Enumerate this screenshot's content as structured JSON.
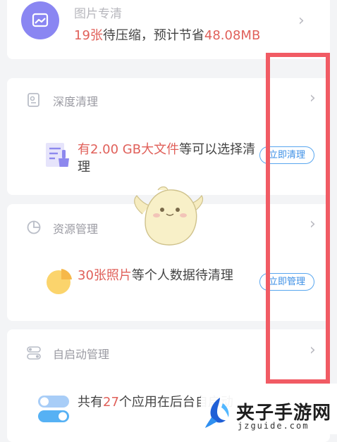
{
  "photo_card": {
    "title": "图片专清",
    "count": "19张",
    "mid_text": "待压缩，预计节省",
    "size": "48.08MB",
    "icon": "image-icon"
  },
  "deep_clean": {
    "title": "深度清理",
    "highlight": "有2.00 GB大文件",
    "text": "等可以选择清理",
    "button": "立即清理",
    "icon": "deep-clean-icon",
    "feature_icon": "file-broom-icon"
  },
  "resource": {
    "title": "资源管理",
    "highlight": "30张照片",
    "text": "等个人数据待清理",
    "button": "立即管理",
    "icon": "pie-chart-icon",
    "feature_icon": "pie-chart-yellow-icon"
  },
  "autostart": {
    "title": "自启动管理",
    "prefix": "共有",
    "count": "27",
    "text": "个应用在后台自启动",
    "icon": "toggle-outline-icon",
    "feature_icon": "toggle-switches-icon"
  },
  "watermark": {
    "name": "夹子手游网",
    "url": "jzguide.com"
  },
  "colors": {
    "highlight_red": "#e0605a",
    "button_blue": "#3c8fe6",
    "annotation_red": "#f15b64",
    "photo_icon_purple": "#8a86f2"
  }
}
